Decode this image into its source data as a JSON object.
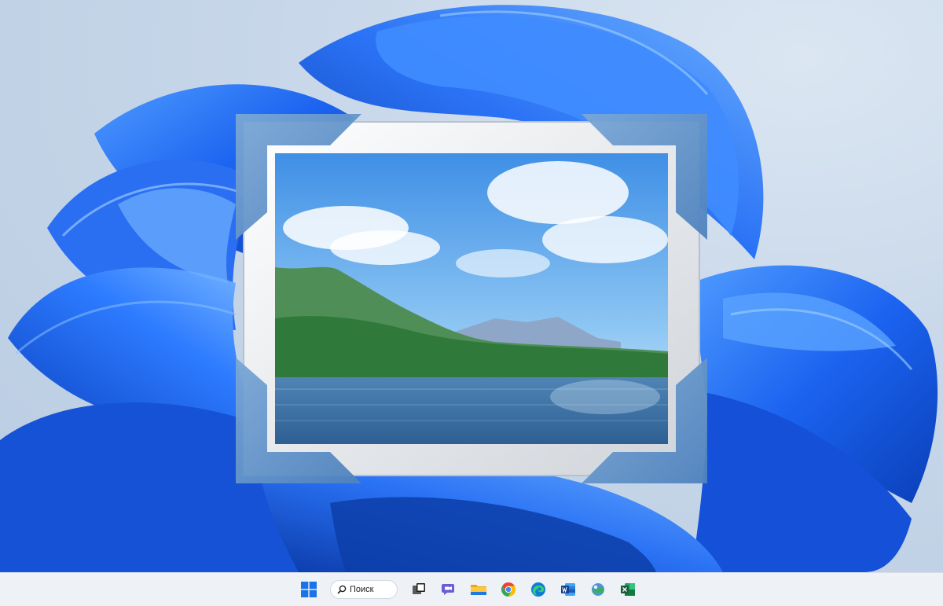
{
  "desktop": {
    "wallpaper": "windows-11-bloom",
    "featured_icon": "windows-photo-viewer-icon"
  },
  "taskbar": {
    "search_label": "Поиск",
    "icons": [
      "start-icon",
      "search-icon",
      "task-view-icon",
      "chat-icon",
      "file-explorer-icon",
      "chrome-icon",
      "edge-icon",
      "word-icon",
      "photo-viewer-icon",
      "excel-icon"
    ]
  },
  "colors": {
    "accent": "#1a5fe0",
    "taskbar_bg": "#eef1f6",
    "wallpaper_bg": "#c9d8ea"
  }
}
